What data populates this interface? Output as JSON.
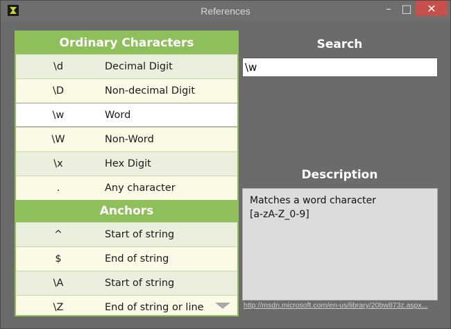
{
  "window": {
    "title": "References",
    "minimize_glyph": "–",
    "maximize_glyph": "□",
    "close_glyph": "✕"
  },
  "sections": [
    {
      "title": "Ordinary Characters",
      "rows": [
        {
          "symbol": "\\d",
          "description": "Decimal Digit"
        },
        {
          "symbol": "\\D",
          "description": "Non-decimal Digit"
        },
        {
          "symbol": "\\w",
          "description": "Word"
        },
        {
          "symbol": "\\W",
          "description": "Non-Word"
        },
        {
          "symbol": "\\x",
          "description": "Hex Digit"
        },
        {
          "symbol": ".",
          "description": "Any character"
        }
      ]
    },
    {
      "title": "Anchors",
      "rows": [
        {
          "symbol": "^",
          "description": "Start of string"
        },
        {
          "symbol": "$",
          "description": "End of string"
        },
        {
          "symbol": "\\A",
          "description": "Start of string"
        },
        {
          "symbol": "\\Z",
          "description": "End of string or line"
        }
      ]
    }
  ],
  "selected_symbol": "\\w",
  "search": {
    "label": "Search",
    "value": "\\w"
  },
  "description": {
    "label": "Description",
    "line1": "Matches a word character",
    "line2": "[a-zA-Z_0-9]"
  },
  "link": {
    "text": "http://msdn.microsoft.com/en-us/library/20bw873z.aspx..."
  },
  "colors": {
    "accent_green": "#8fbf5a",
    "close_red": "#c7504a",
    "background": "#6b6b6b"
  }
}
